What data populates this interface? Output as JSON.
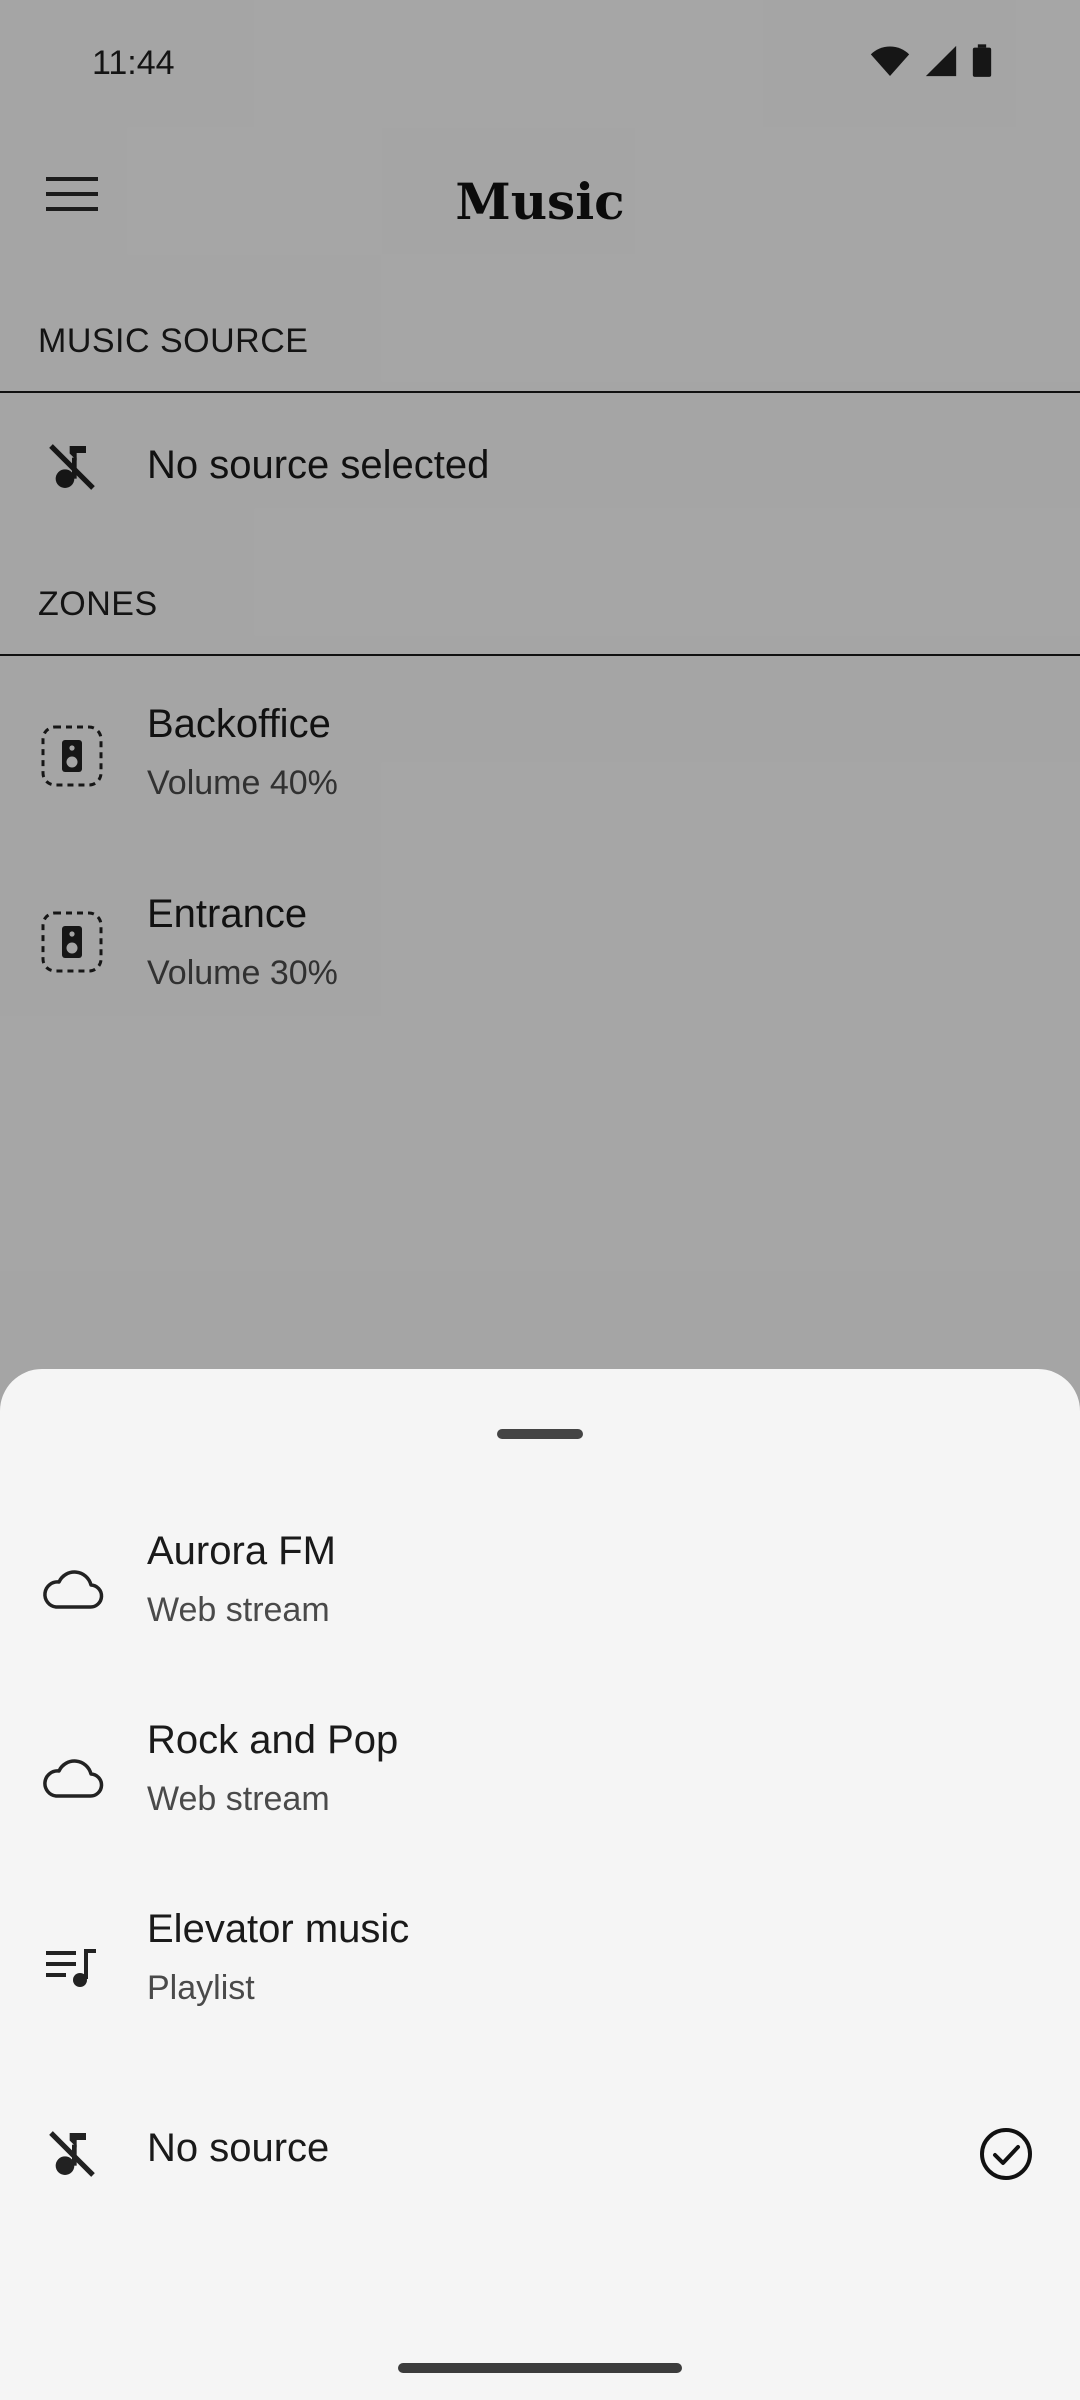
{
  "status_bar": {
    "time": "11:44",
    "icons": [
      "wifi-icon",
      "cell-signal-icon",
      "battery-icon"
    ]
  },
  "app_bar": {
    "title": "Music",
    "menu_icon": "hamburger-menu-icon"
  },
  "music_source": {
    "header": "MUSIC SOURCE",
    "current": {
      "icon": "music-off-icon",
      "label": "No source selected"
    }
  },
  "zones": {
    "header": "ZONES",
    "items": [
      {
        "name": "Backoffice",
        "detail": "Volume 40%",
        "icon": "speaker-icon"
      },
      {
        "name": "Entrance",
        "detail": "Volume 30%",
        "icon": "speaker-icon"
      }
    ]
  },
  "source_sheet": {
    "options": [
      {
        "name": "Aurora FM",
        "detail": "Web stream",
        "icon": "cloud-icon",
        "selected": false
      },
      {
        "name": "Rock and Pop",
        "detail": "Web stream",
        "icon": "cloud-icon",
        "selected": false
      },
      {
        "name": "Elevator music",
        "detail": "Playlist",
        "icon": "playlist-icon",
        "selected": false
      },
      {
        "name": "No source",
        "icon": "music-off-icon",
        "selected": true
      }
    ],
    "selected_icon": "check-circle-icon"
  },
  "colors": {
    "background": "#f7f7f7",
    "sheet": "#f5f5f5",
    "text_primary": "#1a1a1a",
    "text_secondary": "#4a4a4a"
  }
}
